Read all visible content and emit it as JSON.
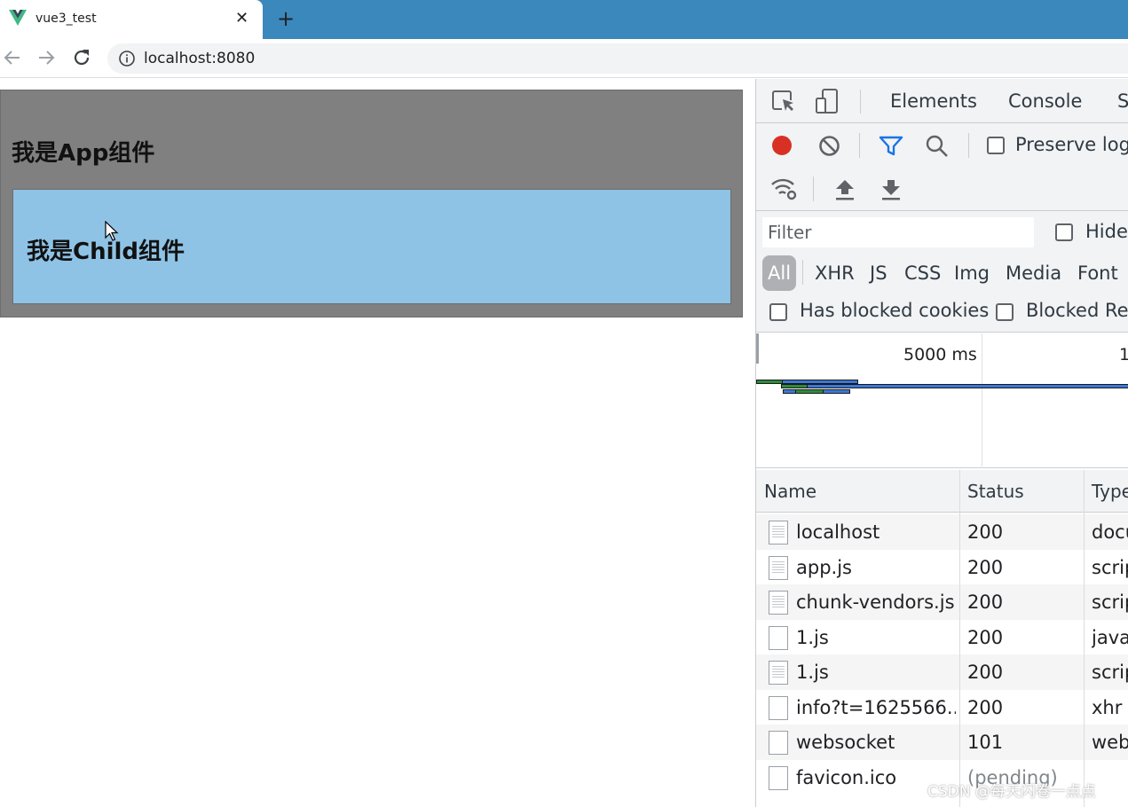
{
  "browser": {
    "tab_title": "vue3_test",
    "tab_close": "✕",
    "new_tab": "+",
    "url": "localhost:8080",
    "icons": [
      "vue-logo-icon",
      "close-icon",
      "plus-icon",
      "back-arrow-icon",
      "forward-arrow-icon",
      "reload-icon",
      "info-icon"
    ]
  },
  "page": {
    "app_heading": "我是App组件",
    "child_heading": "我是Child组件",
    "colors": {
      "app_bg": "#808080",
      "child_bg": "#8fc3e6"
    }
  },
  "devtools": {
    "tabs": [
      "Elements",
      "Console",
      "S"
    ],
    "preserve_log": "Preserve log",
    "filter_placeholder": "Filter",
    "hide_label": "Hide",
    "types": [
      "All",
      "XHR",
      "JS",
      "CSS",
      "Img",
      "Media",
      "Font"
    ],
    "has_blocked_cookies": "Has blocked cookies",
    "blocked_requests": "Blocked Rec",
    "overview": {
      "tick_1": "5000 ms",
      "tick_2": "1"
    },
    "table": {
      "headers": {
        "name": "Name",
        "status": "Status",
        "type": "Type"
      },
      "rows": [
        {
          "name": "localhost",
          "status": "200",
          "type": "document"
        },
        {
          "name": "app.js",
          "status": "200",
          "type": "script"
        },
        {
          "name": "chunk-vendors.js",
          "status": "200",
          "type": "script"
        },
        {
          "name": "1.js",
          "status": "200",
          "type": "javascript"
        },
        {
          "name": "1.js",
          "status": "200",
          "type": "script"
        },
        {
          "name": "info?t=1625566...",
          "status": "200",
          "type": "xhr"
        },
        {
          "name": "websocket",
          "status": "101",
          "type": "websocket"
        },
        {
          "name": "favicon.ico",
          "status": "(pending)",
          "type": ""
        }
      ]
    },
    "colors": {
      "record": "#d93025",
      "filter_active": "#1a73e8",
      "waterfall_green": "#2e8b3d",
      "waterfall_blue": "#3b78d8"
    }
  },
  "watermark": "CSDN @每天闪卷一点点"
}
